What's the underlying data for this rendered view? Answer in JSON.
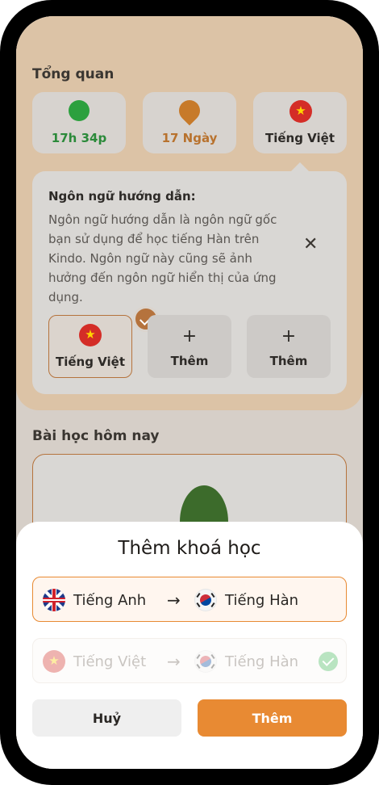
{
  "overview": {
    "title": "Tổng quan",
    "stats": [
      {
        "icon": "timer-icon",
        "text": "17h 34p",
        "color": "#2b8a3a"
      },
      {
        "icon": "fire-icon",
        "text": "17 Ngày",
        "color": "#b8722e"
      },
      {
        "icon": "vietnam-flag-icon",
        "text": "Tiếng Việt",
        "color": "#2d2a27"
      }
    ]
  },
  "guide": {
    "title": "Ngôn ngữ hướng dẫn:",
    "description": "Ngôn ngữ hướng dẫn là ngôn ngữ gốc bạn sử dụng để học tiếng Hàn trên Kindo. Ngôn ngữ này cũng sẽ ảnh hưởng đến ngôn ngữ hiển thị của ứng dụng.",
    "close": "✕",
    "slots": [
      {
        "label": "Tiếng Việt",
        "selected": true
      },
      {
        "label": "Thêm",
        "plus": "+"
      },
      {
        "label": "Thêm",
        "plus": "+"
      }
    ]
  },
  "lessons": {
    "title": "Bài học hôm nay"
  },
  "sheet": {
    "title": "Thêm khoá học",
    "courses": [
      {
        "from": "Tiếng Anh",
        "to": "Tiếng Hàn",
        "arrow": "→",
        "state": "selected"
      },
      {
        "from": "Tiếng Việt",
        "to": "Tiếng Hàn",
        "arrow": "→",
        "state": "added"
      }
    ],
    "cancel_label": "Huỷ",
    "add_label": "Thêm"
  },
  "colors": {
    "accent": "#e88a33",
    "success": "#b9e4c1"
  }
}
